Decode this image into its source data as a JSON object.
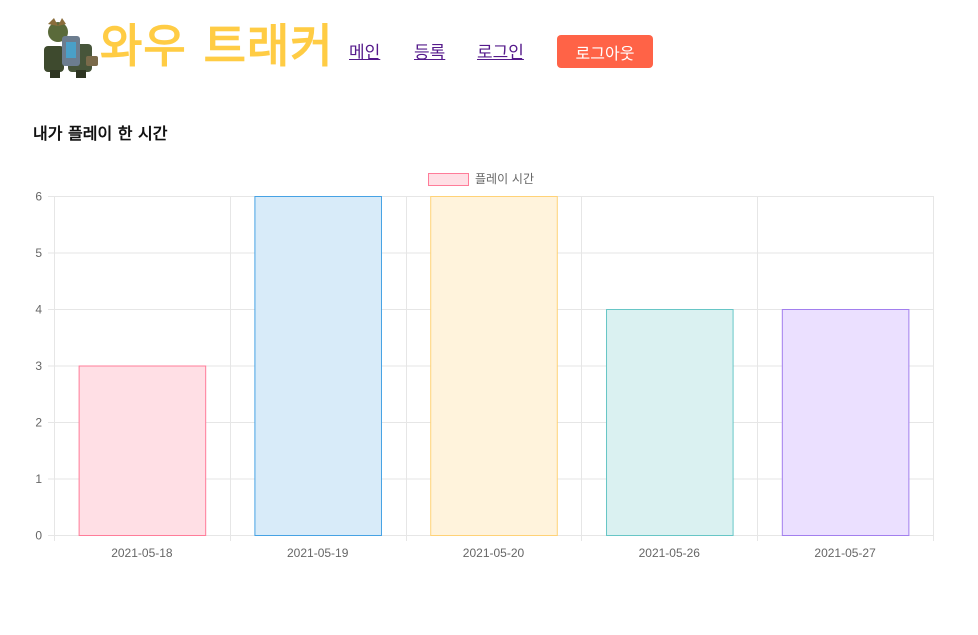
{
  "header": {
    "logo_text": "와우 트래커",
    "nav": {
      "main": "메인",
      "register": "등록",
      "login": "로그인",
      "logout": "로그아웃"
    }
  },
  "page": {
    "section_title": "내가 플레이 한 시간"
  },
  "colors": {
    "logo": "#ffcc44",
    "logout_button": "#ff6347",
    "nav_link": "#551a8b"
  },
  "chart_data": {
    "type": "bar",
    "title": "",
    "xlabel": "",
    "ylabel": "",
    "categories": [
      "2021-05-18",
      "2021-05-19",
      "2021-05-20",
      "2021-05-26",
      "2021-05-27"
    ],
    "series": [
      {
        "name": "플레이 시간",
        "values": [
          3,
          6,
          6,
          4,
          4
        ]
      }
    ],
    "ylim": [
      0,
      6
    ],
    "yticks": [
      0,
      1,
      2,
      3,
      4,
      5,
      6
    ],
    "grid": true,
    "legend": "top-center",
    "bar_colors": [
      {
        "fill": "#ffdfe5",
        "stroke": "#ff7c99"
      },
      {
        "fill": "#d8ebf9",
        "stroke": "#46a2e4"
      },
      {
        "fill": "#fff3dc",
        "stroke": "#ffd277"
      },
      {
        "fill": "#daf1f1",
        "stroke": "#67c6c6"
      },
      {
        "fill": "#ebe0ff",
        "stroke": "#a27fee"
      }
    ]
  }
}
